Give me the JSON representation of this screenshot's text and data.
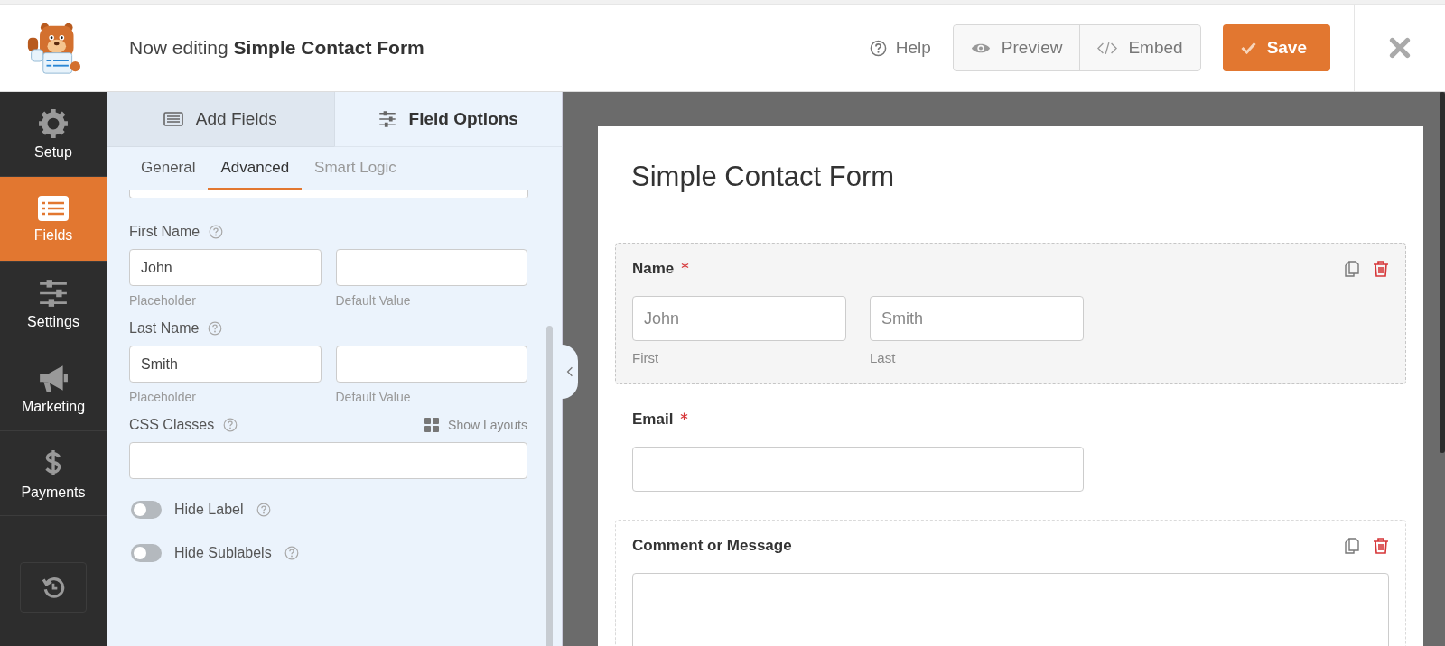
{
  "header": {
    "title": "Now editing **Simple Contact Form**",
    "help": "Help",
    "preview": "Preview",
    "embed": "Embed",
    "save": "Save"
  },
  "sidebar": {
    "items": [
      {
        "label": "Setup",
        "selected": false
      },
      {
        "label": "Fields",
        "selected": true
      },
      {
        "label": "Settings",
        "selected": false
      },
      {
        "label": "Marketing",
        "selected": false
      },
      {
        "label": "Payments",
        "selected": false
      }
    ]
  },
  "panel": {
    "tabs": [
      {
        "label": "Add Fields",
        "selected": false
      },
      {
        "label": "Field Options",
        "selected": true
      }
    ],
    "subtabs": [
      {
        "label": "General",
        "selected": false,
        "disabled": false
      },
      {
        "label": "Advanced",
        "selected": true,
        "disabled": false
      },
      {
        "label": "Smart Logic",
        "selected": false,
        "disabled": true
      }
    ],
    "name_fields": [
      {
        "label": "First Name",
        "inputs": [
          {
            "value": "John",
            "sublabel": "Placeholder"
          },
          {
            "sublabel": "Default Value"
          }
        ]
      },
      {
        "label": "Last Name",
        "inputs": [
          {
            "value": "Smith",
            "sublabel": "Placeholder"
          },
          {
            "sublabel": "Default Value"
          }
        ]
      }
    ],
    "css_classes": {
      "label": "CSS Classes",
      "link": "Show Layouts"
    },
    "toggles": [
      {
        "label": "Hide Label",
        "on": false
      },
      {
        "label": "Hide Sublabels",
        "on": false
      }
    ]
  },
  "form": {
    "title": "Simple Contact Form",
    "fields": [
      {
        "kind": "name",
        "label": "Name",
        "required": true,
        "selected": true,
        "hovered": false,
        "subfields": [
          {
            "placeholder": "John",
            "sublabel": "First"
          },
          {
            "placeholder": "Smith",
            "sublabel": "Last"
          }
        ]
      },
      {
        "kind": "email",
        "label": "Email",
        "required": true,
        "selected": false,
        "hovered": false
      },
      {
        "kind": "textarea",
        "label": "Comment or Message",
        "required": false,
        "selected": false,
        "hovered": true
      }
    ]
  }
}
